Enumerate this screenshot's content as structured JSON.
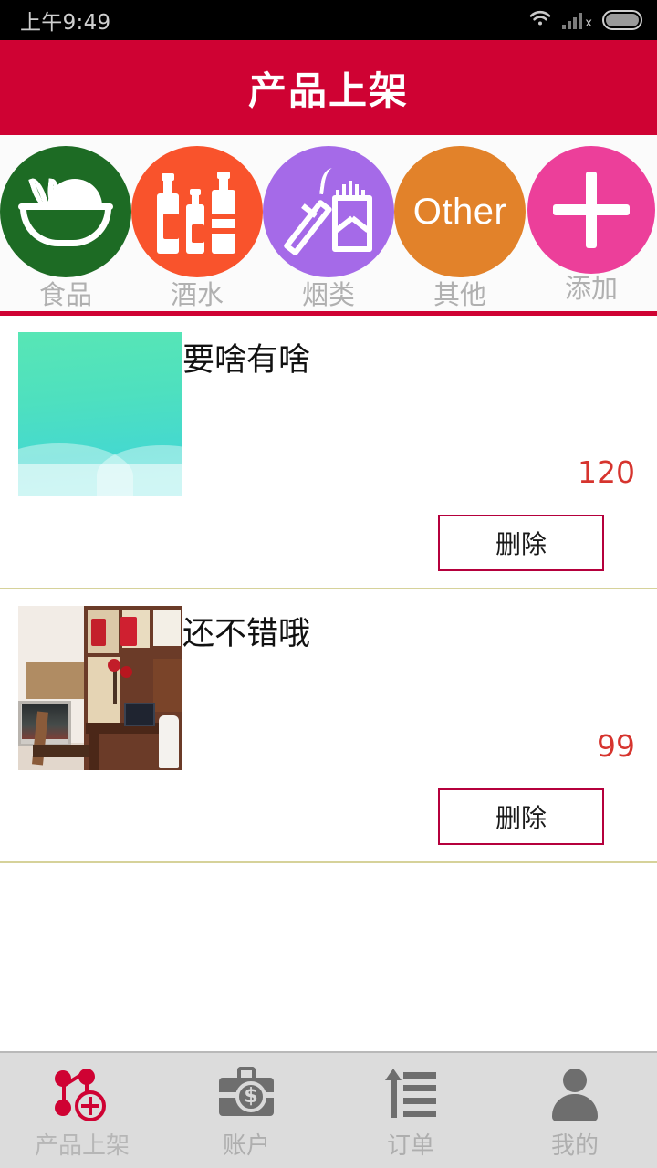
{
  "status_bar": {
    "time": "上午9:49",
    "icons": [
      "wifi-icon",
      "signal-icon",
      "battery-icon"
    ],
    "signal_badge": "x"
  },
  "header": {
    "title": "产品上架",
    "background": "#cf0233",
    "text_color": "#ffffff"
  },
  "categories": [
    {
      "label": "食品",
      "icon": "food-bowl-icon",
      "color": "#1d6b24"
    },
    {
      "label": "酒水",
      "icon": "bottles-icon",
      "color": "#f9532c"
    },
    {
      "label": "烟类",
      "icon": "cigarette-icon",
      "color": "#a governor"
    },
    {
      "label": "其他",
      "icon": "other-text-icon",
      "text": "Other",
      "color": "#e2822a"
    },
    {
      "label": "添加",
      "icon": "plus-icon",
      "color": "#ec3f9a"
    }
  ],
  "category_colors": {
    "food": "#1d6b24",
    "drinks": "#f9532c",
    "tobacco": "#a56ae8",
    "other": "#e2822a",
    "add": "#ec3f9a"
  },
  "products": [
    {
      "title": "要啥有啥",
      "price": "120",
      "delete_label": "删除",
      "thumbnail": "mint-gradient-wave-image"
    },
    {
      "title": "还不错哦",
      "price": "99",
      "delete_label": "删除",
      "thumbnail": "furniture-room-photo"
    }
  ],
  "colors": {
    "accent_red": "#cf0233",
    "price_red": "#d6342e",
    "delete_border": "#b5003c",
    "divider": "#d6d29a",
    "nav_bg": "#dcdcdc",
    "nav_label": "#aeaeae"
  },
  "bottom_nav": [
    {
      "label": "产品上架",
      "icon": "product-listing-icon",
      "active": true
    },
    {
      "label": "账户",
      "icon": "briefcase-dollar-icon",
      "active": false
    },
    {
      "label": "订单",
      "icon": "order-list-icon",
      "active": false
    },
    {
      "label": "我的",
      "icon": "user-profile-icon",
      "active": false
    }
  ]
}
